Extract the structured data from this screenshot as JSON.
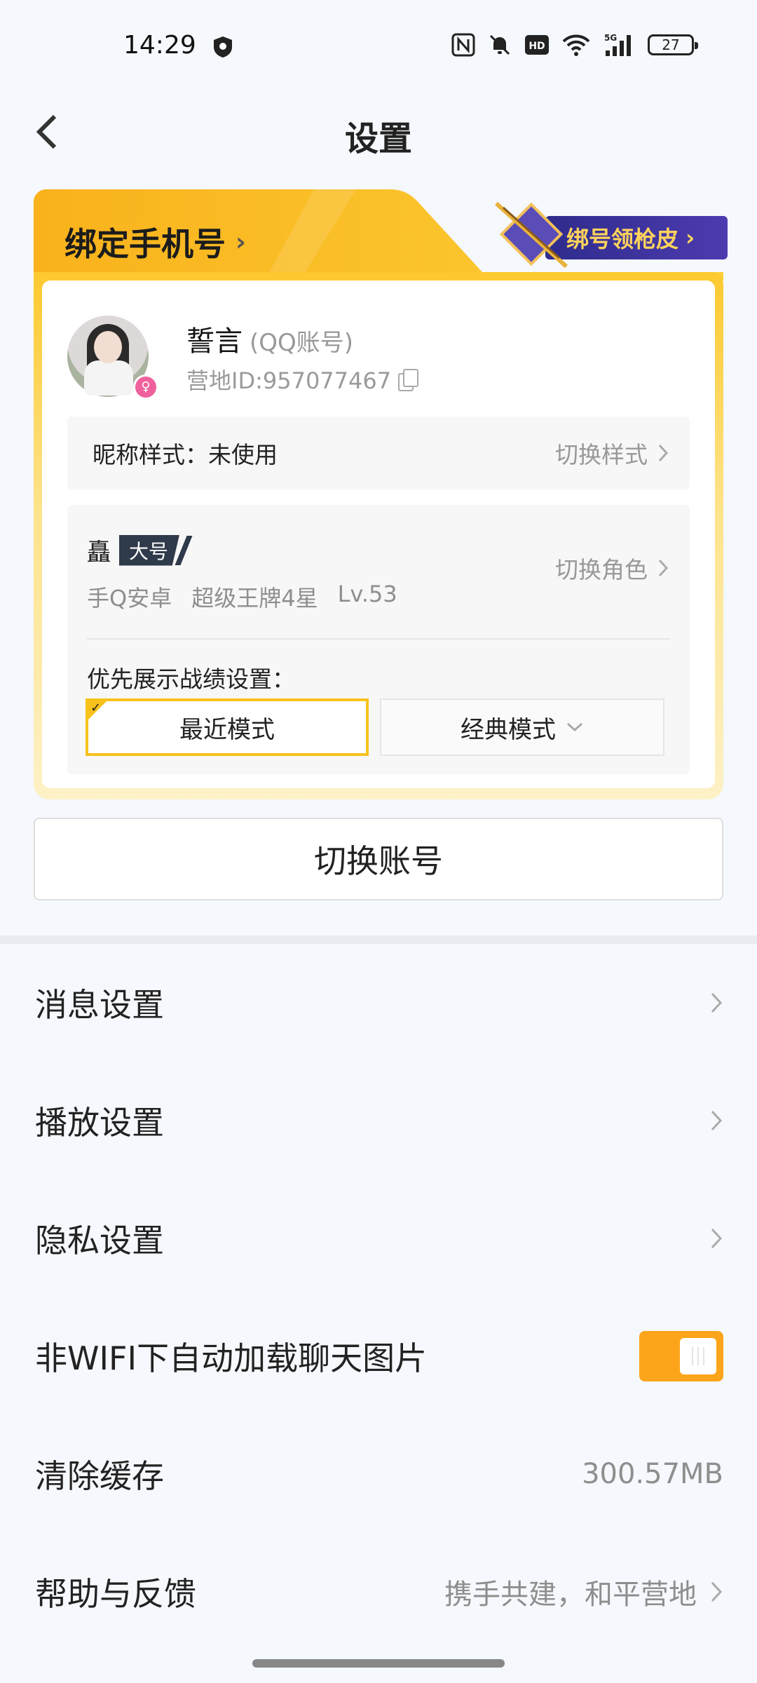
{
  "status_bar": {
    "time": "14:29",
    "battery": "27",
    "icons": [
      "shield-icon",
      "nfc-icon",
      "mute-bell-icon",
      "hd-icon",
      "wifi-icon",
      "5g-signal-icon"
    ]
  },
  "nav": {
    "title": "设置",
    "back_icon": "chevron-left-icon"
  },
  "account_card": {
    "header_title": "绑定手机号",
    "promo_label": "绑号领枪皮",
    "user": {
      "name": "誓言",
      "account_type": "(QQ账号)",
      "camp_id": "营地ID:957077467"
    },
    "nickname_style": {
      "label": "昵称样式：未使用",
      "action": "切换样式"
    },
    "role": {
      "name": "矗",
      "tag": "大号",
      "platform": "手Q安卓",
      "rank": "超级王牌4星",
      "level": "Lv.53",
      "action": "切换角色"
    },
    "priority": {
      "label": "优先展示战绩设置：",
      "mode_recent": "最近模式",
      "mode_classic": "经典模式",
      "selected": "最近模式"
    }
  },
  "switch_account_label": "切换账号",
  "settings": {
    "message": "消息设置",
    "playback": "播放设置",
    "privacy": "隐私设置",
    "auto_load": "非WIFI下自动加载聊天图片",
    "auto_load_enabled": true,
    "clear_cache": "清除缓存",
    "cache_size": "300.57MB",
    "help": "帮助与反馈",
    "help_sub": "携手共建，和平营地"
  },
  "colors": {
    "accent": "#fca51a",
    "card_yellow": "#fcc92e",
    "promo_purple": "#3a32a0"
  }
}
